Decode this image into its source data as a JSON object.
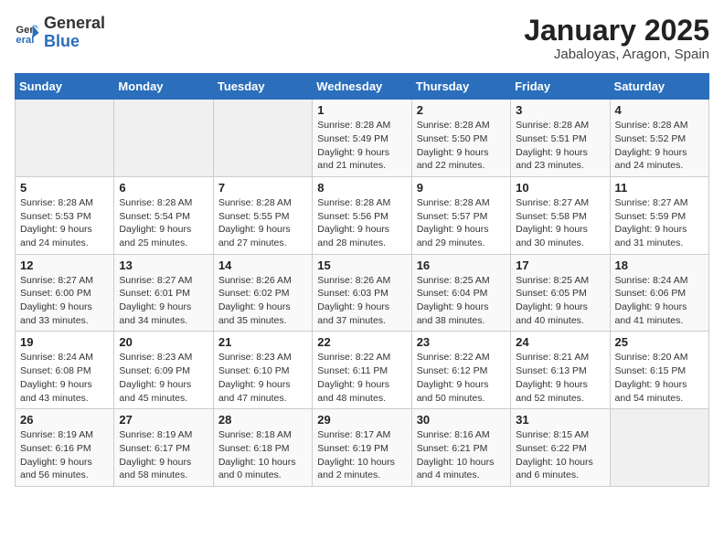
{
  "header": {
    "logo_general": "General",
    "logo_blue": "Blue",
    "month": "January 2025",
    "location": "Jabaloyas, Aragon, Spain"
  },
  "days_of_week": [
    "Sunday",
    "Monday",
    "Tuesday",
    "Wednesday",
    "Thursday",
    "Friday",
    "Saturday"
  ],
  "weeks": [
    [
      {
        "day": "",
        "info": ""
      },
      {
        "day": "",
        "info": ""
      },
      {
        "day": "",
        "info": ""
      },
      {
        "day": "1",
        "info": "Sunrise: 8:28 AM\nSunset: 5:49 PM\nDaylight: 9 hours\nand 21 minutes."
      },
      {
        "day": "2",
        "info": "Sunrise: 8:28 AM\nSunset: 5:50 PM\nDaylight: 9 hours\nand 22 minutes."
      },
      {
        "day": "3",
        "info": "Sunrise: 8:28 AM\nSunset: 5:51 PM\nDaylight: 9 hours\nand 23 minutes."
      },
      {
        "day": "4",
        "info": "Sunrise: 8:28 AM\nSunset: 5:52 PM\nDaylight: 9 hours\nand 24 minutes."
      }
    ],
    [
      {
        "day": "5",
        "info": "Sunrise: 8:28 AM\nSunset: 5:53 PM\nDaylight: 9 hours\nand 24 minutes."
      },
      {
        "day": "6",
        "info": "Sunrise: 8:28 AM\nSunset: 5:54 PM\nDaylight: 9 hours\nand 25 minutes."
      },
      {
        "day": "7",
        "info": "Sunrise: 8:28 AM\nSunset: 5:55 PM\nDaylight: 9 hours\nand 27 minutes."
      },
      {
        "day": "8",
        "info": "Sunrise: 8:28 AM\nSunset: 5:56 PM\nDaylight: 9 hours\nand 28 minutes."
      },
      {
        "day": "9",
        "info": "Sunrise: 8:28 AM\nSunset: 5:57 PM\nDaylight: 9 hours\nand 29 minutes."
      },
      {
        "day": "10",
        "info": "Sunrise: 8:27 AM\nSunset: 5:58 PM\nDaylight: 9 hours\nand 30 minutes."
      },
      {
        "day": "11",
        "info": "Sunrise: 8:27 AM\nSunset: 5:59 PM\nDaylight: 9 hours\nand 31 minutes."
      }
    ],
    [
      {
        "day": "12",
        "info": "Sunrise: 8:27 AM\nSunset: 6:00 PM\nDaylight: 9 hours\nand 33 minutes."
      },
      {
        "day": "13",
        "info": "Sunrise: 8:27 AM\nSunset: 6:01 PM\nDaylight: 9 hours\nand 34 minutes."
      },
      {
        "day": "14",
        "info": "Sunrise: 8:26 AM\nSunset: 6:02 PM\nDaylight: 9 hours\nand 35 minutes."
      },
      {
        "day": "15",
        "info": "Sunrise: 8:26 AM\nSunset: 6:03 PM\nDaylight: 9 hours\nand 37 minutes."
      },
      {
        "day": "16",
        "info": "Sunrise: 8:25 AM\nSunset: 6:04 PM\nDaylight: 9 hours\nand 38 minutes."
      },
      {
        "day": "17",
        "info": "Sunrise: 8:25 AM\nSunset: 6:05 PM\nDaylight: 9 hours\nand 40 minutes."
      },
      {
        "day": "18",
        "info": "Sunrise: 8:24 AM\nSunset: 6:06 PM\nDaylight: 9 hours\nand 41 minutes."
      }
    ],
    [
      {
        "day": "19",
        "info": "Sunrise: 8:24 AM\nSunset: 6:08 PM\nDaylight: 9 hours\nand 43 minutes."
      },
      {
        "day": "20",
        "info": "Sunrise: 8:23 AM\nSunset: 6:09 PM\nDaylight: 9 hours\nand 45 minutes."
      },
      {
        "day": "21",
        "info": "Sunrise: 8:23 AM\nSunset: 6:10 PM\nDaylight: 9 hours\nand 47 minutes."
      },
      {
        "day": "22",
        "info": "Sunrise: 8:22 AM\nSunset: 6:11 PM\nDaylight: 9 hours\nand 48 minutes."
      },
      {
        "day": "23",
        "info": "Sunrise: 8:22 AM\nSunset: 6:12 PM\nDaylight: 9 hours\nand 50 minutes."
      },
      {
        "day": "24",
        "info": "Sunrise: 8:21 AM\nSunset: 6:13 PM\nDaylight: 9 hours\nand 52 minutes."
      },
      {
        "day": "25",
        "info": "Sunrise: 8:20 AM\nSunset: 6:15 PM\nDaylight: 9 hours\nand 54 minutes."
      }
    ],
    [
      {
        "day": "26",
        "info": "Sunrise: 8:19 AM\nSunset: 6:16 PM\nDaylight: 9 hours\nand 56 minutes."
      },
      {
        "day": "27",
        "info": "Sunrise: 8:19 AM\nSunset: 6:17 PM\nDaylight: 9 hours\nand 58 minutes."
      },
      {
        "day": "28",
        "info": "Sunrise: 8:18 AM\nSunset: 6:18 PM\nDaylight: 10 hours\nand 0 minutes."
      },
      {
        "day": "29",
        "info": "Sunrise: 8:17 AM\nSunset: 6:19 PM\nDaylight: 10 hours\nand 2 minutes."
      },
      {
        "day": "30",
        "info": "Sunrise: 8:16 AM\nSunset: 6:21 PM\nDaylight: 10 hours\nand 4 minutes."
      },
      {
        "day": "31",
        "info": "Sunrise: 8:15 AM\nSunset: 6:22 PM\nDaylight: 10 hours\nand 6 minutes."
      },
      {
        "day": "",
        "info": ""
      }
    ]
  ]
}
